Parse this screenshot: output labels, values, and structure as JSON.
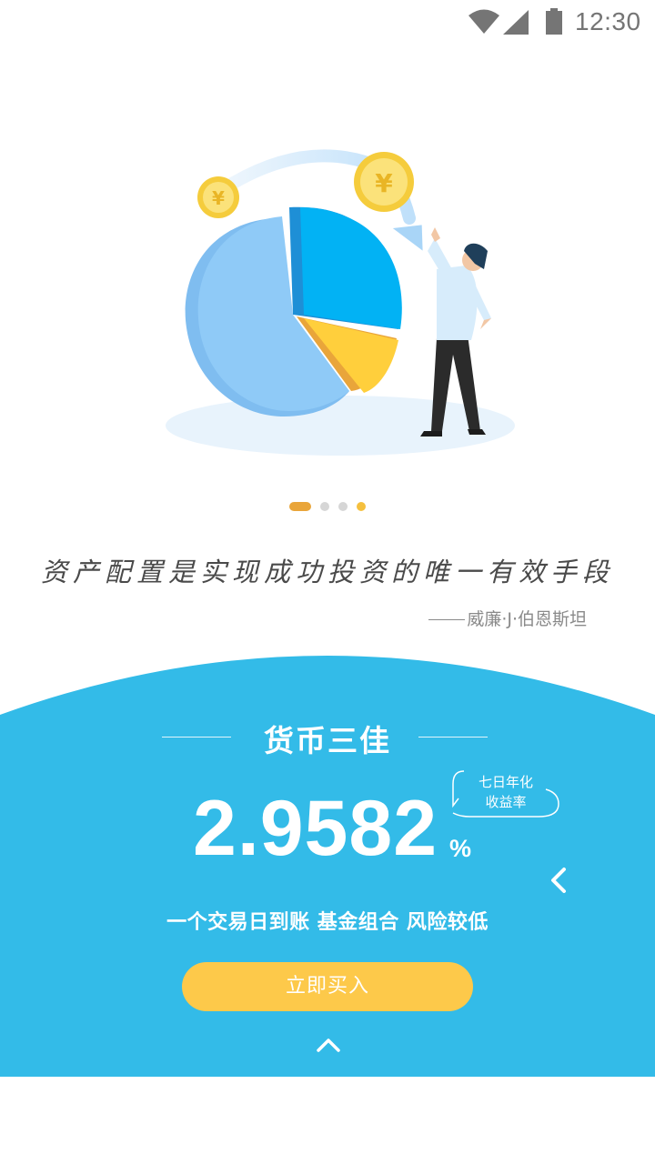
{
  "status_bar": {
    "time": "12:30",
    "icons": [
      "wifi-icon",
      "signal-icon",
      "battery-icon"
    ]
  },
  "illustration": {
    "subject": "pie-chart-with-coins-and-person"
  },
  "pager": {
    "count": 4,
    "active_index": 0
  },
  "quote": {
    "text": "资产配置是实现成功投资的唯一有效手段",
    "author": "威廉·J·伯恩斯坦"
  },
  "product": {
    "name": "货币三佳",
    "yield_value": "2.9582",
    "yield_unit": "%",
    "yield_label_line1": "七日年化",
    "yield_label_line2": "收益率",
    "features": "一个交易日到账 基金组合 风险较低",
    "buy_label": "立即买入"
  },
  "colors": {
    "panel_blue": "#33bbe8",
    "button_yellow": "#fdc94a",
    "pager_active": "#e9a53a",
    "pager_inactive": "#d6d6d6",
    "pager_highlight": "#f5c03e"
  }
}
